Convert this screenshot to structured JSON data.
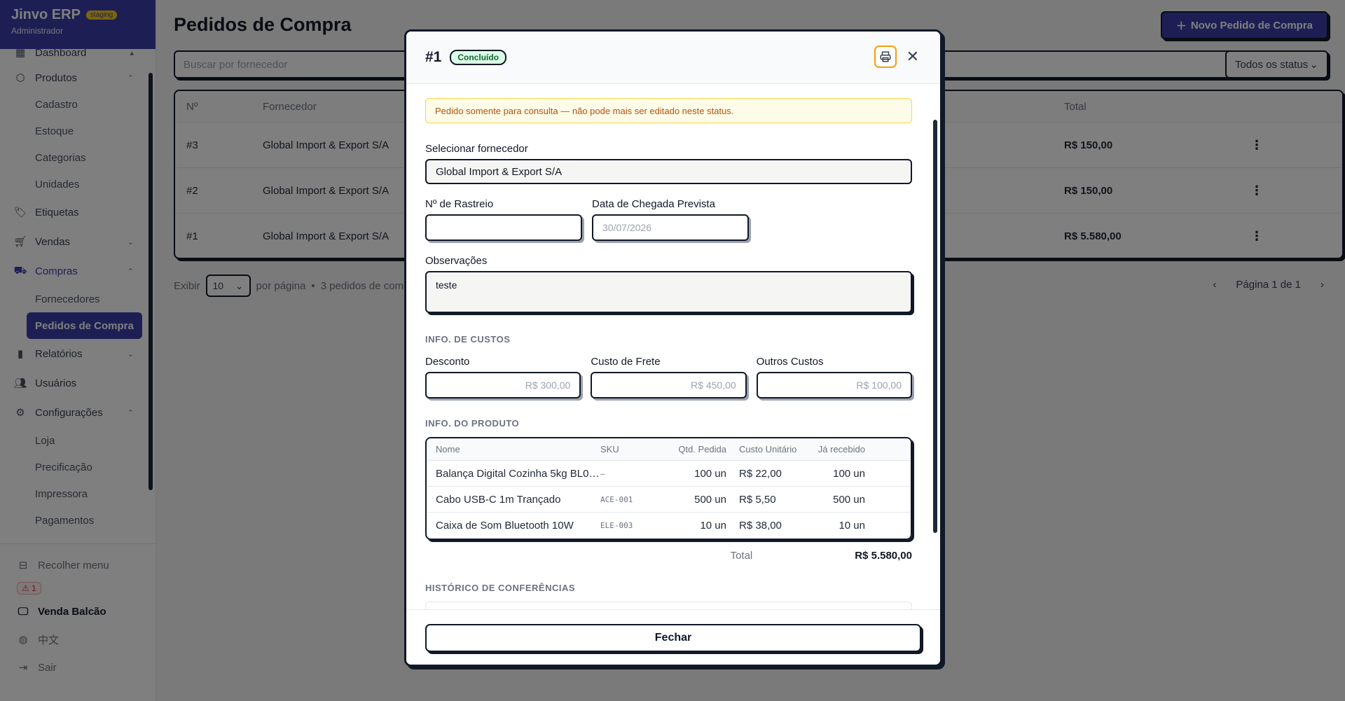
{
  "sidebar": {
    "brand": "Jinvo ERP",
    "env_badge": "staging",
    "role": "Administrador",
    "items": {
      "dashboard": "Dashboard",
      "produtos": "Produtos",
      "cadastro": "Cadastro",
      "estoque": "Estoque",
      "categorias": "Categorias",
      "unidades": "Unidades",
      "etiquetas": "Etiquetas",
      "vendas": "Vendas",
      "compras": "Compras",
      "fornecedores": "Fornecedores",
      "pedidos": "Pedidos de Compra",
      "relatorios": "Relatórios",
      "usuarios": "Usuários",
      "configuracoes": "Configurações",
      "loja": "Loja",
      "precificacao": "Precificação",
      "impressora": "Impressora",
      "pagamentos": "Pagamentos"
    },
    "bottom": {
      "collapse": "Recolher menu",
      "alerts": "⚠ 1",
      "pos": "Venda Balcão",
      "language": "中文",
      "logout": "Sair"
    }
  },
  "main": {
    "title": "Pedidos de Compra",
    "new_button": "Novo Pedido de Compra",
    "search_placeholder": "Buscar por fornecedor",
    "status_filter": "Todos os status",
    "table": {
      "headers": {
        "no": "Nº",
        "supplier": "Fornecedor",
        "total": "Total"
      },
      "rows": [
        {
          "no": "#3",
          "supplier": "Global Import & Export S/A",
          "total": "R$ 150,00"
        },
        {
          "no": "#2",
          "supplier": "Global Import & Export S/A",
          "total": "R$ 150,00"
        },
        {
          "no": "#1",
          "supplier": "Global Import & Export S/A",
          "total": "R$ 5.580,00"
        }
      ]
    },
    "footer": {
      "show": "Exibir",
      "per_page_value": "10",
      "per_page": "por página",
      "sep": "•",
      "count": "3 pedidos de comp",
      "page": "Página 1 de 1"
    }
  },
  "modal": {
    "title": "#1",
    "status": "Concluído",
    "notice": "Pedido somente para consulta — não pode mais ser editado neste status.",
    "supplier_label": "Selecionar fornecedor",
    "supplier_value": "Global Import & Export S/A",
    "tracking_label": "Nº de Rastreio",
    "tracking_value": "",
    "arrival_label": "Data de Chegada Prevista",
    "arrival_value": "30/07/2026",
    "notes_label": "Observações",
    "notes_value": "teste",
    "costs_section": "INFO. DE CUSTOS",
    "discount_label": "Desconto",
    "discount_value": "R$ 300,00",
    "freight_label": "Custo de Frete",
    "freight_value": "R$ 450,00",
    "other_label": "Outros Custos",
    "other_value": "R$ 100,00",
    "product_section": "INFO. DO PRODUTO",
    "product_headers": {
      "name": "Nome",
      "sku": "SKU",
      "qty": "Qtd. Pedida",
      "cost": "Custo Unitário",
      "received": "Já recebido"
    },
    "products": [
      {
        "name": "Balança Digital Cozinha 5kg BL0…",
        "sku": "—",
        "qty": "100 un",
        "cost": "R$ 22,00",
        "received": "100 un"
      },
      {
        "name": "Cabo USB-C 1m Trançado",
        "sku": "ACE-001",
        "qty": "500 un",
        "cost": "R$ 5,50",
        "received": "500 un"
      },
      {
        "name": "Caixa de Som Bluetooth 10W",
        "sku": "ELE-003",
        "qty": "10 un",
        "cost": "R$ 38,00",
        "received": "10 un"
      }
    ],
    "total_label": "Total",
    "total_value": "R$ 5.580,00",
    "history_section": "HISTÓRICO DE CONFERÊNCIAS",
    "close_button": "Fechar"
  }
}
